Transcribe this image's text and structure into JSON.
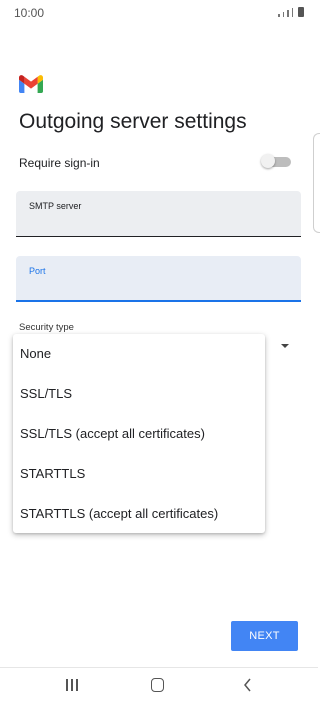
{
  "status_bar": {
    "time": "10:00"
  },
  "app": {
    "logo": "gmail-logo",
    "title": "Outgoing server settings"
  },
  "require_signin": {
    "label": "Require sign-in",
    "enabled": false
  },
  "fields": {
    "smtp": {
      "label": "SMTP server",
      "value": ""
    },
    "port": {
      "label": "Port",
      "value": ""
    }
  },
  "security": {
    "label": "Security type",
    "options": [
      "None",
      "SSL/TLS",
      "SSL/TLS (accept all certificates)",
      "STARTTLS",
      "STARTTLS (accept all certificates)"
    ]
  },
  "actions": {
    "next_label": "NEXT"
  },
  "colors": {
    "accent": "#1a73e8",
    "button": "#4285f4",
    "field_bg": "#eceef1"
  },
  "nav": {
    "icons": [
      "recent-apps-icon",
      "home-icon",
      "back-icon"
    ]
  }
}
